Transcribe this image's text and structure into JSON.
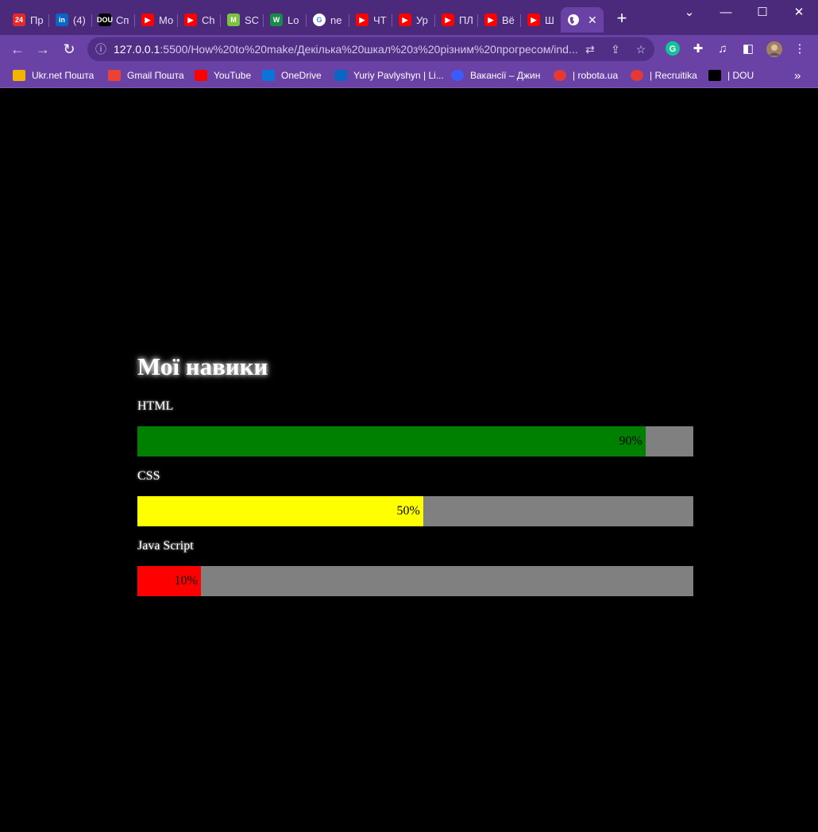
{
  "browser": {
    "tabs": [
      {
        "title": "Пр",
        "icon": "24-news-icon",
        "color": "#e32b2b",
        "glyph": "24"
      },
      {
        "title": "(4)",
        "icon": "linkedin-icon",
        "color": "#0a66c2",
        "glyph": "in"
      },
      {
        "title": "Сп",
        "icon": "dou-icon",
        "color": "#000000",
        "glyph": "DOU"
      },
      {
        "title": "Мо",
        "icon": "youtube-icon",
        "color": "#ff0000",
        "glyph": "▶"
      },
      {
        "title": "Ch",
        "icon": "youtube-icon",
        "color": "#ff0000",
        "glyph": "▶"
      },
      {
        "title": "SC",
        "icon": "m-logo-icon",
        "color": "#7cc242",
        "glyph": "M"
      },
      {
        "title": "Lo",
        "icon": "w-logo-icon",
        "color": "#1a8a4a",
        "glyph": "W"
      },
      {
        "title": "ne",
        "icon": "google-icon",
        "color": "#ffffff",
        "glyph": "G"
      },
      {
        "title": "ЧТ",
        "icon": "youtube-icon",
        "color": "#ff0000",
        "glyph": "▶"
      },
      {
        "title": "Ур",
        "icon": "youtube-icon",
        "color": "#ff0000",
        "glyph": "▶"
      },
      {
        "title": "ПЛ",
        "icon": "youtube-icon",
        "color": "#ff0000",
        "glyph": "▶"
      },
      {
        "title": "Вё",
        "icon": "youtube-icon",
        "color": "#ff0000",
        "glyph": "▶"
      },
      {
        "title": "Ш",
        "icon": "youtube-icon",
        "color": "#ff0000",
        "glyph": "▶"
      }
    ],
    "active_tab_icon": "globe-icon",
    "url_host": "127.0.0.1",
    "url_rest": ":5500/How%20to%20make/Декілька%20шкал%20з%20різним%20прогресом/ind...",
    "bookmarks": [
      {
        "label": "Ukr.net Пошта",
        "icon": "ukrnet-icon",
        "color": "#f5b400"
      },
      {
        "label": "Gmail Пошта",
        "icon": "gmail-icon",
        "color": "#ea4335"
      },
      {
        "label": "YouTube",
        "icon": "youtube-icon",
        "color": "#ff0000"
      },
      {
        "label": "OneDrive",
        "icon": "onedrive-icon",
        "color": "#0a74da"
      },
      {
        "label": "Yuriy Pavlyshyn | Li...",
        "icon": "linkedin-icon",
        "color": "#0a66c2"
      },
      {
        "label": "Вакансії – Джин",
        "icon": "djinni-icon",
        "color": "#3d5afe"
      },
      {
        "label": "| robota.ua",
        "icon": "robota-icon",
        "color": "#e53935"
      },
      {
        "label": "| Recruitika",
        "icon": "recruitika-icon",
        "color": "#e53935"
      },
      {
        "label": "| DOU",
        "icon": "dou-icon",
        "color": "#000000"
      }
    ]
  },
  "page": {
    "title": "Мої навики",
    "skills": [
      {
        "label": "HTML",
        "value_text": "90%",
        "fraction": 0.914,
        "color": "#008000"
      },
      {
        "label": "CSS",
        "value_text": "50%",
        "fraction": 0.514,
        "color": "#ffff00"
      },
      {
        "label": "Java Script",
        "value_text": "10%",
        "fraction": 0.114,
        "color": "#ff0000"
      }
    ]
  }
}
